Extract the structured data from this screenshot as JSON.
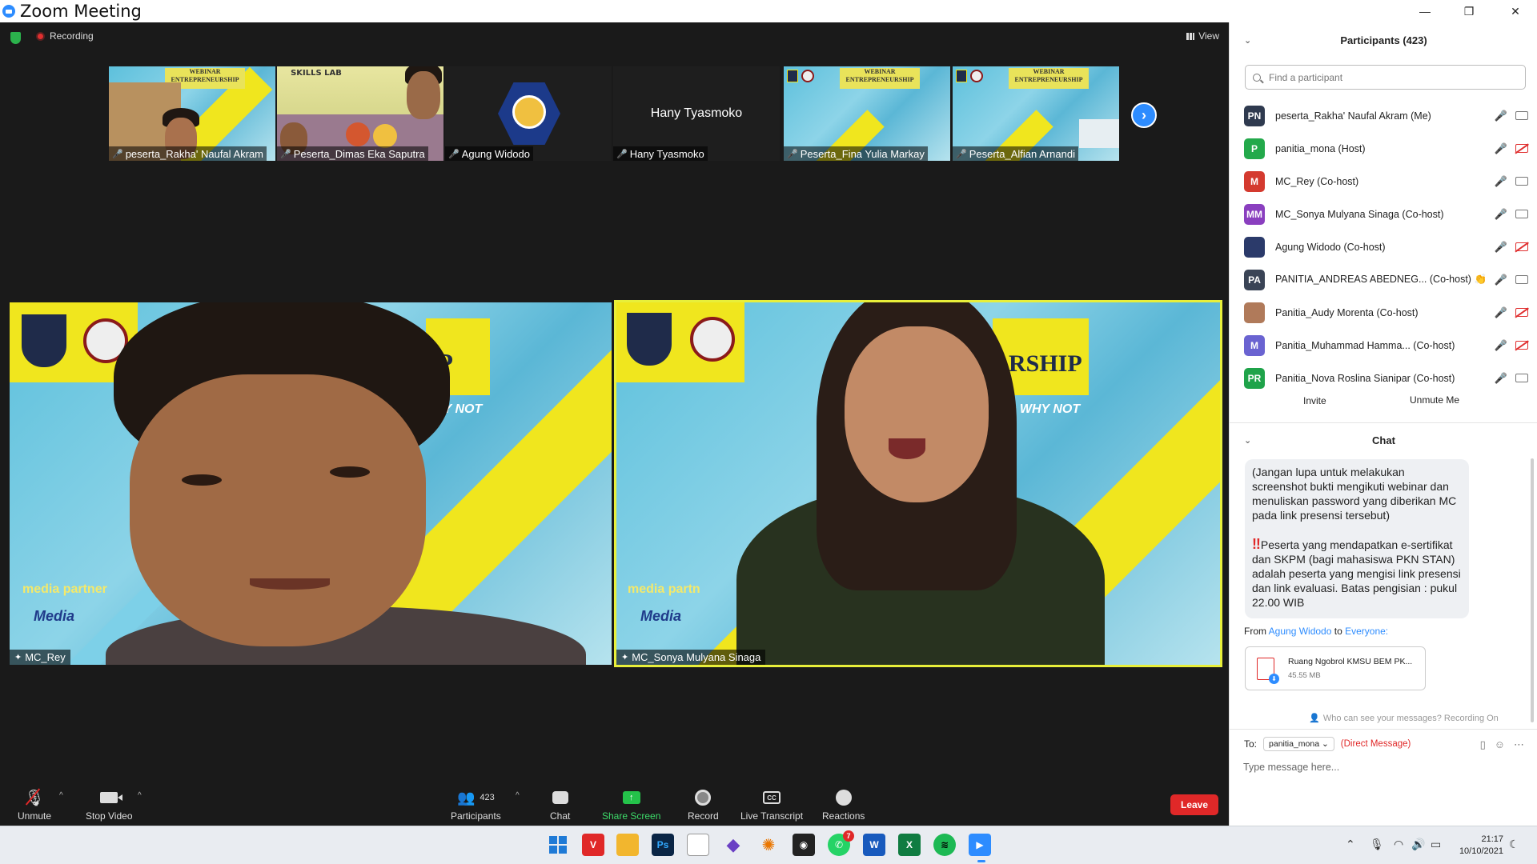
{
  "window": {
    "title": "Zoom Meeting"
  },
  "status": {
    "recording": "Recording",
    "view": "View"
  },
  "thumbnails": [
    {
      "name": "peserta_Rakha' Naufal Akram",
      "banner": "WEBINAR\nENTREPRENEURSHIP"
    },
    {
      "name": "Peserta_Dimas Eka Saputra",
      "banner": "SKILLS LAB"
    },
    {
      "name": "Agung Widodo"
    },
    {
      "name": "Hany Tyasmoko",
      "center_text": "Hany Tyasmoko"
    },
    {
      "name": "Peserta_Fina Yulia Markay",
      "banner": "WEBINAR\nENTREPRENEURSHIP"
    },
    {
      "name": "Peserta_Alfian Arnandi",
      "banner": "WEBINAR\nENTREPRENEURSHIP"
    }
  ],
  "main_tiles": [
    {
      "name": "MC_Rey",
      "bg_text_1": "media partner",
      "bg_text_2": "Media",
      "bg_text_3": "IP",
      "bg_text_4": "WHY NOT"
    },
    {
      "name": "MC_Sonya Mulyana Sinaga",
      "bg_text_1": "media partn",
      "bg_text_2": "Media",
      "bg_text_3": "RSHIP",
      "bg_text_4": "O WHY NOT"
    }
  ],
  "toolbar": {
    "unmute": "Unmute",
    "stop_video": "Stop Video",
    "participants": "Participants",
    "participants_count": "423",
    "chat": "Chat",
    "share_screen": "Share Screen",
    "record": "Record",
    "live_transcript": "Live Transcript",
    "reactions": "Reactions",
    "leave": "Leave"
  },
  "participants_panel": {
    "title": "Participants (423)",
    "search_placeholder": "Find a participant",
    "rows": [
      {
        "initials": "PN",
        "name": "peserta_Rakha' Naufal Akram (Me)",
        "color": "#2f3a4f"
      },
      {
        "initials": "P",
        "name": "panitia_mona (Host)",
        "color": "#23a94b"
      },
      {
        "initials": "M",
        "name": "MC_Rey (Co-host)",
        "color": "#d43a2f"
      },
      {
        "initials": "MM",
        "name": "MC_Sonya Mulyana Sinaga (Co-host)",
        "color": "#8a3fbf"
      },
      {
        "initials": "",
        "name": "Agung Widodo (Co-host)",
        "color": "#2b3a6a"
      },
      {
        "initials": "PA",
        "name": "PANITIA_ANDREAS ABEDNEG... (Co-host) 👏",
        "color": "#3a4456"
      },
      {
        "initials": "",
        "name": "Panitia_Audy Morenta (Co-host)",
        "color": "#b07a5a"
      },
      {
        "initials": "M",
        "name": "Panitia_Muhammad Hamma...  (Co-host)",
        "color": "#6a63d1"
      },
      {
        "initials": "PR",
        "name": "Panitia_Nova Roslina Sianipar (Co-host)",
        "color": "#1fa34a"
      }
    ],
    "invite": "Invite",
    "unmute_me": "Unmute Me"
  },
  "chat_panel": {
    "title": "Chat",
    "message_part1": "(Jangan lupa untuk melakukan screenshot bukti mengikuti webinar dan menuliskan password yang diberikan MC pada link presensi tersebut)",
    "message_mark": "‼",
    "message_part2": "Peserta yang mendapatkan e-sertifikat dan SKPM (bagi mahasiswa PKN STAN) adalah peserta yang mengisi link presensi dan link evaluasi. Batas pengisian : pukul 22.00 WIB",
    "from_prefix": "From",
    "from_name": "Agung Widodo",
    "from_to": "to",
    "from_target": "Everyone:",
    "file_name": "Ruang Ngobrol KMSU BEM PK...",
    "file_size": "45.55 MB",
    "visibility": "Who can see your messages? Recording On",
    "to_label": "To:",
    "to_value": "panitia_mona",
    "direct": "(Direct Message)",
    "input_placeholder": "Type message here..."
  },
  "taskbar": {
    "whatsapp_badge": "7",
    "time": "21:17",
    "date": "10/10/2021"
  }
}
